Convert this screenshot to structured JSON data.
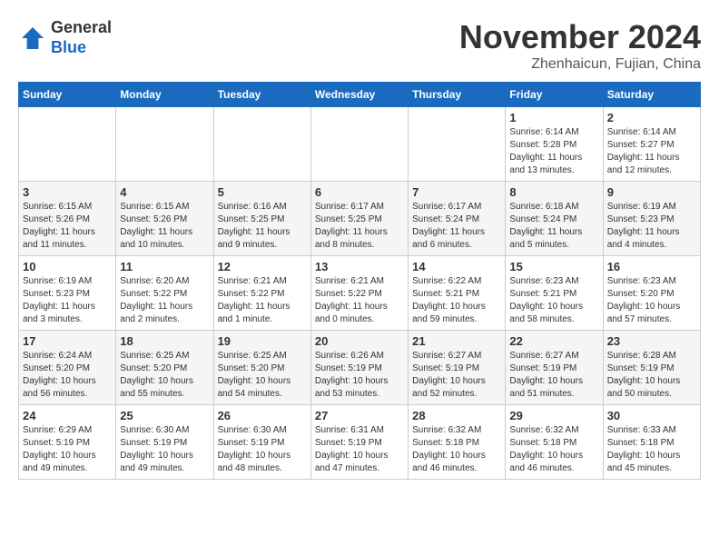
{
  "logo": {
    "general": "General",
    "blue": "Blue"
  },
  "title": "November 2024",
  "subtitle": "Zhenhaicun, Fujian, China",
  "days_of_week": [
    "Sunday",
    "Monday",
    "Tuesday",
    "Wednesday",
    "Thursday",
    "Friday",
    "Saturday"
  ],
  "weeks": [
    [
      {
        "day": "",
        "info": ""
      },
      {
        "day": "",
        "info": ""
      },
      {
        "day": "",
        "info": ""
      },
      {
        "day": "",
        "info": ""
      },
      {
        "day": "",
        "info": ""
      },
      {
        "day": "1",
        "info": "Sunrise: 6:14 AM\nSunset: 5:28 PM\nDaylight: 11 hours\nand 13 minutes."
      },
      {
        "day": "2",
        "info": "Sunrise: 6:14 AM\nSunset: 5:27 PM\nDaylight: 11 hours\nand 12 minutes."
      }
    ],
    [
      {
        "day": "3",
        "info": "Sunrise: 6:15 AM\nSunset: 5:26 PM\nDaylight: 11 hours\nand 11 minutes."
      },
      {
        "day": "4",
        "info": "Sunrise: 6:15 AM\nSunset: 5:26 PM\nDaylight: 11 hours\nand 10 minutes."
      },
      {
        "day": "5",
        "info": "Sunrise: 6:16 AM\nSunset: 5:25 PM\nDaylight: 11 hours\nand 9 minutes."
      },
      {
        "day": "6",
        "info": "Sunrise: 6:17 AM\nSunset: 5:25 PM\nDaylight: 11 hours\nand 8 minutes."
      },
      {
        "day": "7",
        "info": "Sunrise: 6:17 AM\nSunset: 5:24 PM\nDaylight: 11 hours\nand 6 minutes."
      },
      {
        "day": "8",
        "info": "Sunrise: 6:18 AM\nSunset: 5:24 PM\nDaylight: 11 hours\nand 5 minutes."
      },
      {
        "day": "9",
        "info": "Sunrise: 6:19 AM\nSunset: 5:23 PM\nDaylight: 11 hours\nand 4 minutes."
      }
    ],
    [
      {
        "day": "10",
        "info": "Sunrise: 6:19 AM\nSunset: 5:23 PM\nDaylight: 11 hours\nand 3 minutes."
      },
      {
        "day": "11",
        "info": "Sunrise: 6:20 AM\nSunset: 5:22 PM\nDaylight: 11 hours\nand 2 minutes."
      },
      {
        "day": "12",
        "info": "Sunrise: 6:21 AM\nSunset: 5:22 PM\nDaylight: 11 hours\nand 1 minute."
      },
      {
        "day": "13",
        "info": "Sunrise: 6:21 AM\nSunset: 5:22 PM\nDaylight: 11 hours\nand 0 minutes."
      },
      {
        "day": "14",
        "info": "Sunrise: 6:22 AM\nSunset: 5:21 PM\nDaylight: 10 hours\nand 59 minutes."
      },
      {
        "day": "15",
        "info": "Sunrise: 6:23 AM\nSunset: 5:21 PM\nDaylight: 10 hours\nand 58 minutes."
      },
      {
        "day": "16",
        "info": "Sunrise: 6:23 AM\nSunset: 5:20 PM\nDaylight: 10 hours\nand 57 minutes."
      }
    ],
    [
      {
        "day": "17",
        "info": "Sunrise: 6:24 AM\nSunset: 5:20 PM\nDaylight: 10 hours\nand 56 minutes."
      },
      {
        "day": "18",
        "info": "Sunrise: 6:25 AM\nSunset: 5:20 PM\nDaylight: 10 hours\nand 55 minutes."
      },
      {
        "day": "19",
        "info": "Sunrise: 6:25 AM\nSunset: 5:20 PM\nDaylight: 10 hours\nand 54 minutes."
      },
      {
        "day": "20",
        "info": "Sunrise: 6:26 AM\nSunset: 5:19 PM\nDaylight: 10 hours\nand 53 minutes."
      },
      {
        "day": "21",
        "info": "Sunrise: 6:27 AM\nSunset: 5:19 PM\nDaylight: 10 hours\nand 52 minutes."
      },
      {
        "day": "22",
        "info": "Sunrise: 6:27 AM\nSunset: 5:19 PM\nDaylight: 10 hours\nand 51 minutes."
      },
      {
        "day": "23",
        "info": "Sunrise: 6:28 AM\nSunset: 5:19 PM\nDaylight: 10 hours\nand 50 minutes."
      }
    ],
    [
      {
        "day": "24",
        "info": "Sunrise: 6:29 AM\nSunset: 5:19 PM\nDaylight: 10 hours\nand 49 minutes."
      },
      {
        "day": "25",
        "info": "Sunrise: 6:30 AM\nSunset: 5:19 PM\nDaylight: 10 hours\nand 49 minutes."
      },
      {
        "day": "26",
        "info": "Sunrise: 6:30 AM\nSunset: 5:19 PM\nDaylight: 10 hours\nand 48 minutes."
      },
      {
        "day": "27",
        "info": "Sunrise: 6:31 AM\nSunset: 5:19 PM\nDaylight: 10 hours\nand 47 minutes."
      },
      {
        "day": "28",
        "info": "Sunrise: 6:32 AM\nSunset: 5:18 PM\nDaylight: 10 hours\nand 46 minutes."
      },
      {
        "day": "29",
        "info": "Sunrise: 6:32 AM\nSunset: 5:18 PM\nDaylight: 10 hours\nand 46 minutes."
      },
      {
        "day": "30",
        "info": "Sunrise: 6:33 AM\nSunset: 5:18 PM\nDaylight: 10 hours\nand 45 minutes."
      }
    ]
  ]
}
